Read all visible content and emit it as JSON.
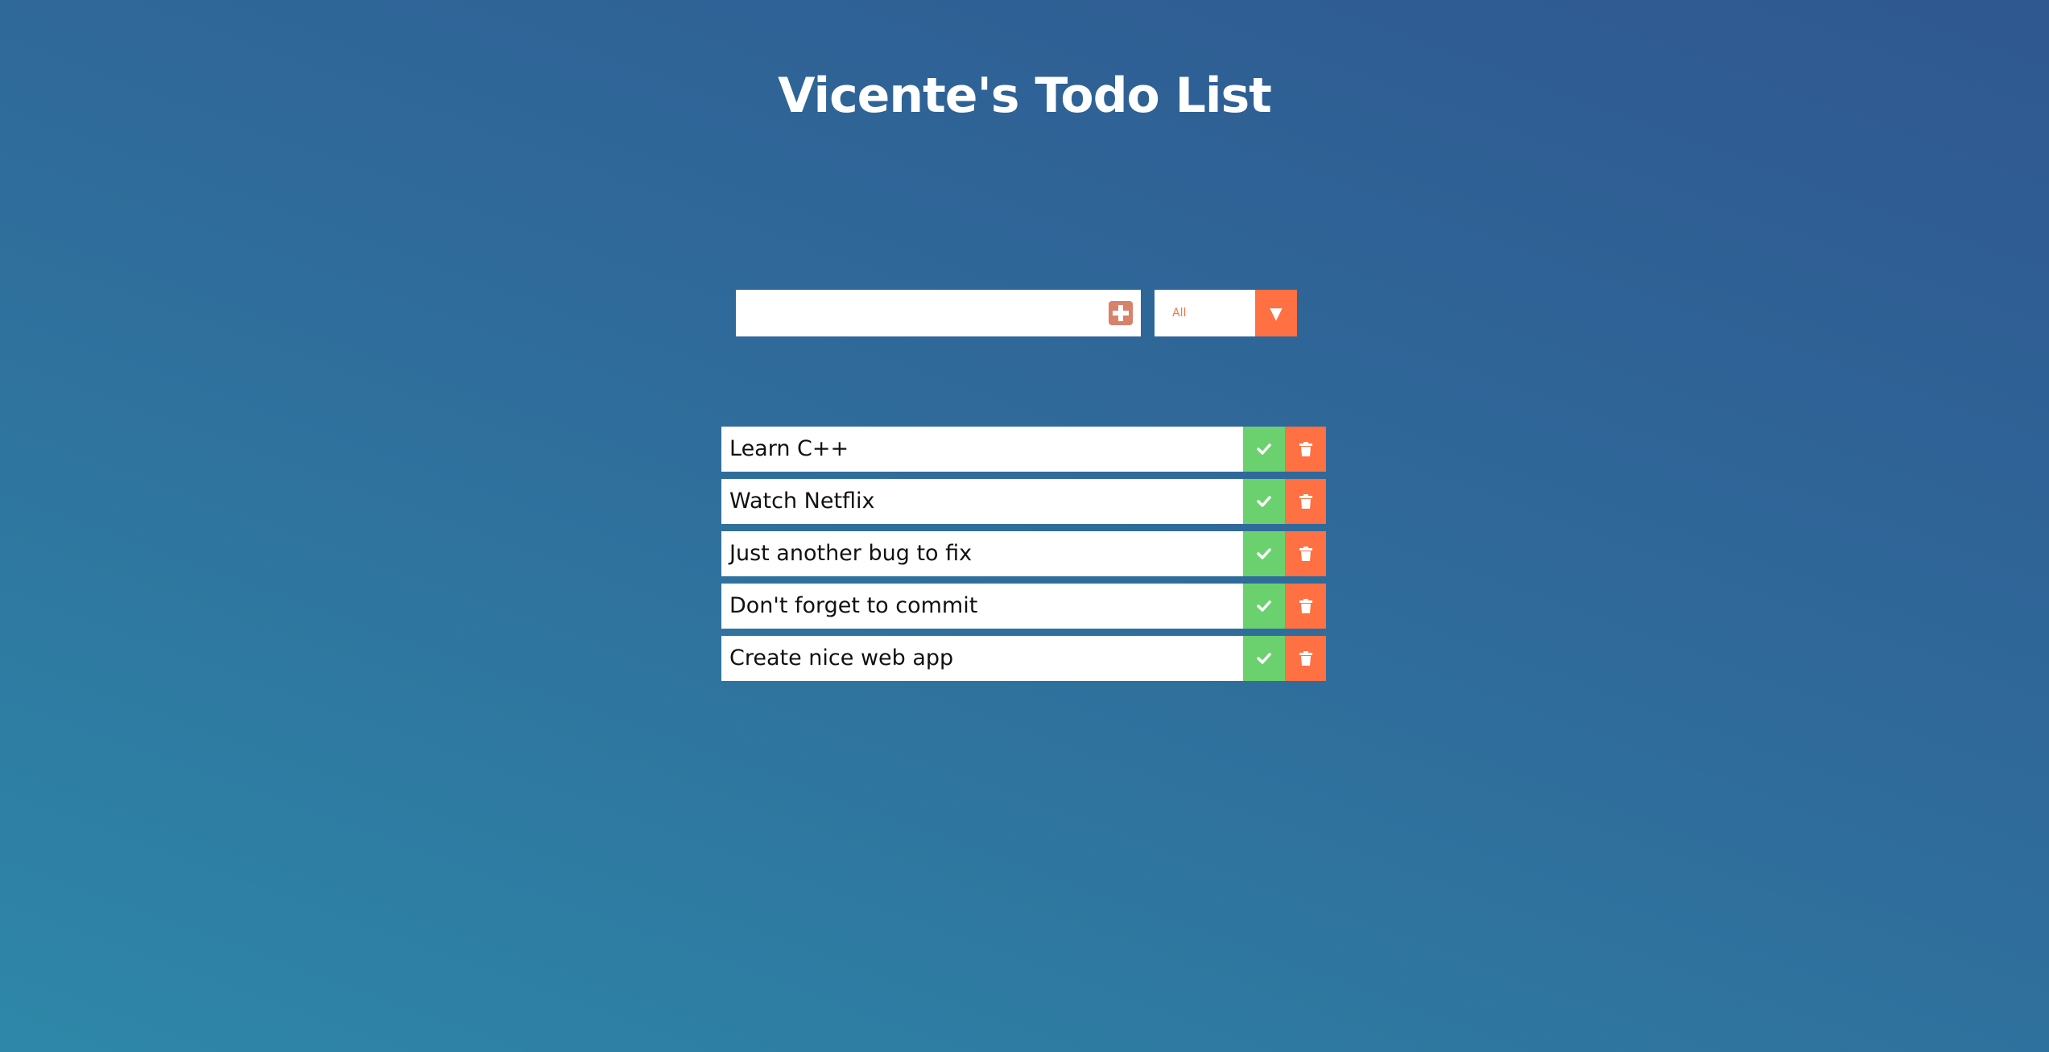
{
  "header": {
    "title": "Vicente's Todo List"
  },
  "form": {
    "input_value": "",
    "add_icon": "plus-square-icon",
    "filter": {
      "selected": "All",
      "arrow_icon": "triangle-down-icon"
    }
  },
  "todos": [
    {
      "text": "Learn C++"
    },
    {
      "text": "Watch Netflix"
    },
    {
      "text": "Just another bug to fix"
    },
    {
      "text": "Don't forget to commit"
    },
    {
      "text": "Create nice web app"
    }
  ],
  "colors": {
    "accent": "#ff7043",
    "complete": "#6bd16f",
    "add_button": "#d9826b",
    "background_top": "#2f5790",
    "background_bottom": "#2e87a8"
  }
}
